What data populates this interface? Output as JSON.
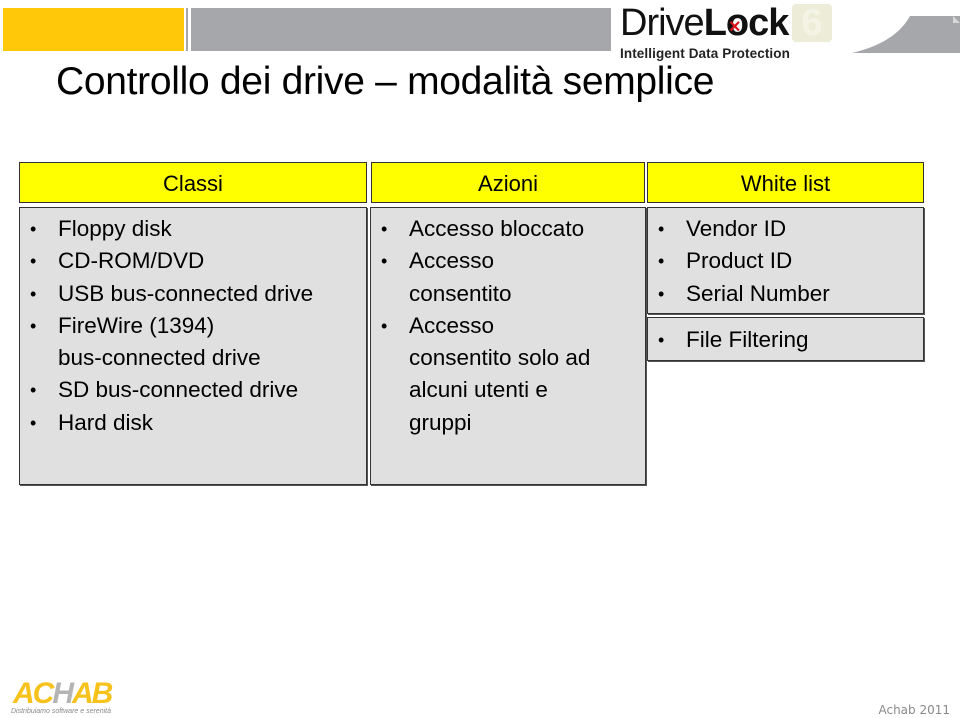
{
  "slide": {
    "title": "Controllo dei drive – modalità semplice",
    "logo": {
      "brand_regular": "Drive",
      "brand_bold_l": "L",
      "brand_mark": "×",
      "brand_bold_rest": "ck",
      "version": "6",
      "tagline": "Intelligent Data Protection"
    },
    "columns": [
      {
        "header": "Classi",
        "items": [
          "Floppy disk",
          "CD-ROM/DVD",
          "USB bus-connected drive",
          "FireWire (1394)\nbus-connected drive",
          "SD bus-connected drive",
          "Hard disk"
        ]
      },
      {
        "header": "Azioni",
        "items": [
          "Accesso bloccato",
          "Accesso\nconsentito",
          "Accesso\nconsentito solo ad\nalcuni utenti e\ngruppi"
        ]
      },
      {
        "header": "White list",
        "items": [
          "Vendor ID",
          "Product ID",
          "Serial Number"
        ],
        "extra_items": [
          "File Filtering"
        ]
      }
    ],
    "bullet_glyph": "•",
    "footer_logo": {
      "word_a": "AC",
      "word_h": "H",
      "word_b": "AB",
      "tagline": "Distribuiamo software e serenità"
    },
    "footer_text": "Achab 2011",
    "colors": {
      "accent_yellow": "#ffc90a",
      "header_yellow": "#ffff00",
      "band_gray": "#a6a7ab",
      "box_gray": "#e0e0e0",
      "logo_red": "#d9141b"
    }
  }
}
